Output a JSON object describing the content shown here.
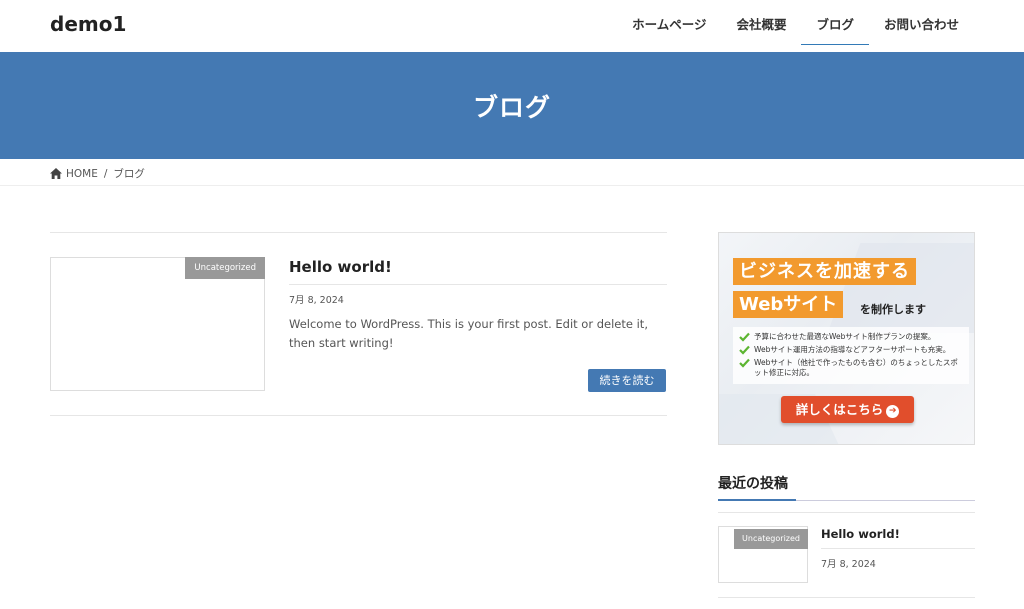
{
  "header": {
    "logo": "demo1",
    "nav": [
      {
        "label": "ホームページ"
      },
      {
        "label": "会社概要"
      },
      {
        "label": "ブログ"
      },
      {
        "label": "お問い合わせ"
      }
    ]
  },
  "page_header": {
    "title": "ブログ"
  },
  "breadcrumb": {
    "home": "HOME",
    "separator": "/",
    "current": "ブログ"
  },
  "post": {
    "category": "Uncategorized",
    "title": "Hello world!",
    "date": "7月 8, 2024",
    "excerpt": "Welcome to WordPress. This is your first post. Edit or delete it, then start writing!",
    "read_more": "続きを読む"
  },
  "banner": {
    "line1": "ビジネスを加速する",
    "line2": "Webサイト",
    "line2_suffix": "を制作します",
    "checks": [
      "予算に合わせた最適なWebサイト制作プランの提案。",
      "Webサイト運用方法の指導などアフターサポートも充実。",
      "Webサイト（他社で作ったものも含む）のちょっとしたスポット修正に対応。"
    ],
    "cta": "詳しくはこちら"
  },
  "sidebar": {
    "recent_title": "最近の投稿",
    "recent_posts": [
      {
        "category": "Uncategorized",
        "title": "Hello world!",
        "date": "7月 8, 2024"
      }
    ]
  },
  "colors": {
    "accent": "#4479b3",
    "banner_orange": "#f29a2e",
    "cta_red": "#e14e2c",
    "category_gray": "#999999"
  },
  "icons": {
    "home": "home-icon",
    "check": "check-icon",
    "arrow": "arrow-right-circle-icon"
  }
}
